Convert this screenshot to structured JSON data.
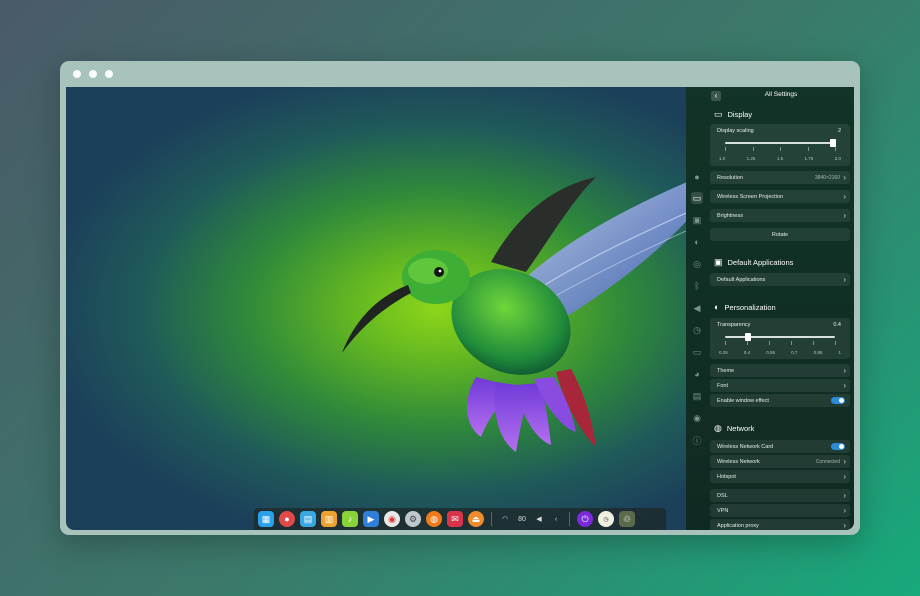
{
  "panel": {
    "top_title": "All Settings",
    "display": {
      "title": "Display",
      "scaling_label": "Display scaling",
      "scaling_value": "2",
      "scaling_ticks": [
        "1.0",
        "1.25",
        "1.5",
        "1.75",
        "2.0"
      ],
      "resolution_label": "Resolution",
      "resolution_value": "3840×2160",
      "projection_label": "Wireless Screen Projection",
      "brightness_label": "Brightness",
      "rotate_label": "Rotate"
    },
    "default_apps": {
      "title": "Default Applications",
      "item_label": "Default Applications"
    },
    "personalization": {
      "title": "Personalization",
      "transparency_label": "Transparency",
      "transparency_value": "0.4",
      "transparency_ticks": [
        "0.25",
        "0.4",
        "0.55",
        "0.7",
        "0.85",
        "1"
      ],
      "theme_label": "Theme",
      "font_label": "Font",
      "window_effect_label": "Enable window effect",
      "window_effect_on": true
    },
    "network": {
      "title": "Network",
      "wireless_card_label": "Wireless Network Card",
      "wireless_card_on": true,
      "wireless_network_label": "Wireless Network",
      "wireless_network_value": "Connected",
      "hotspot_label": "Hotspot",
      "dsl_label": "DSL",
      "vpn_label": "VPN",
      "proxy_label": "Application proxy"
    }
  },
  "sidebar_icons": [
    "user-icon",
    "display-icon",
    "window-icon",
    "personalization-icon",
    "network-icon",
    "bluetooth-icon",
    "sound-icon",
    "time-icon",
    "power-icon",
    "mouse-icon",
    "keyboard-icon",
    "update-icon",
    "info-icon"
  ],
  "dock": {
    "apps": [
      "launcher",
      "browser-red",
      "file-manager",
      "store",
      "music",
      "video",
      "chrome",
      "settings",
      "firefox",
      "mail",
      "media"
    ],
    "tray_text": "80"
  },
  "colors": {
    "accent": "#2b8bd7",
    "panel_bg": "#123327"
  }
}
